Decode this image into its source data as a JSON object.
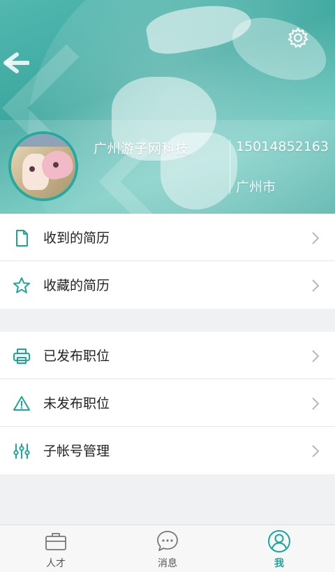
{
  "header": {
    "company_name": "广州游子网科技",
    "phone": "15014852163",
    "city": "广州市",
    "back_icon": "back-arrow-icon",
    "settings_icon": "gear-icon"
  },
  "menu_group_1": [
    {
      "label": "收到的简历",
      "icon": "document-icon"
    },
    {
      "label": "收藏的简历",
      "icon": "star-icon"
    }
  ],
  "menu_group_2": [
    {
      "label": "已发布职位",
      "icon": "printer-icon"
    },
    {
      "label": "未发布职位",
      "icon": "warning-icon"
    },
    {
      "label": "子帐号管理",
      "icon": "sliders-icon"
    }
  ],
  "tabs": [
    {
      "label": "人才",
      "icon": "briefcase-icon",
      "active": false
    },
    {
      "label": "消息",
      "icon": "chat-bubble-icon",
      "active": false
    },
    {
      "label": "我",
      "icon": "user-circle-icon",
      "active": true
    }
  ],
  "colors": {
    "accent": "#1aa69d",
    "header_bg": "#45ada5",
    "page_bg": "#f0f1f3"
  }
}
